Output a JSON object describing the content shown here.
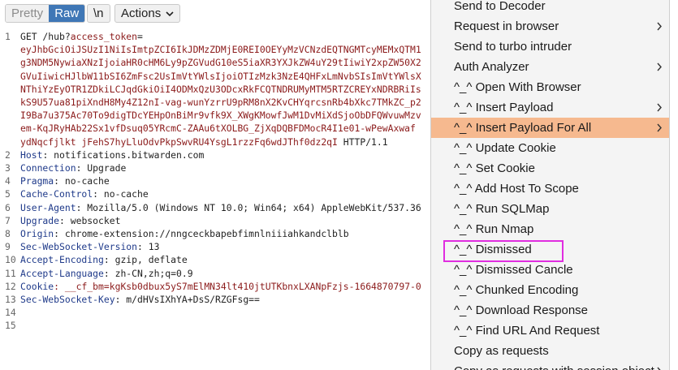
{
  "toolbar": {
    "pretty_label": "Pretty",
    "raw_label": "Raw",
    "newline_label": "\\n",
    "actions_label": "Actions"
  },
  "editor": {
    "line_numbers": [
      "1",
      "",
      "",
      "",
      "",
      "",
      "",
      "",
      "",
      "2",
      "3",
      "4",
      "5",
      "6",
      "7",
      "8",
      "9",
      "10",
      "11",
      "12",
      "13",
      "14",
      "15"
    ],
    "lines": [
      {
        "a": "GET /hub?",
        "b": "access_token",
        "c": "="
      },
      {
        "a": "eyJhbGciOiJSUzI1NiIsImtpZCI6IkJDMzZDMjE0REI0OEYyMzVCNzdEQTNGMTcyMEMxQTM1",
        "b": "",
        "c": ""
      },
      {
        "a": "g3NDM5NywiaXNzIjoiaHR0cHM6Ly9pZGVudG10eS5iaXR3YXJkZW4uY29tIiwiY2xpZW50X2",
        "b": "",
        "c": ""
      },
      {
        "a": "GVuIiwicHJlbW11bSI6ZmFsc2UsImVtYWlsIjoiOTIzMzk3NzE4QHFxLmNvbSIsImVtYWlsX",
        "b": "",
        "c": ""
      },
      {
        "a": "NThiYzEyOTR1ZDkiLCJqdGkiOiI4ODMxQzU3ODcxRkFCQTNDRUMyMTM5RTZCREYxNDRBRiIs",
        "b": "",
        "c": ""
      },
      {
        "a": "kS9U57ua81piXndH8My4Z12nI-vag-wunYzrrU9pRM8nX2KvCHYqrcsnRb4bXkc7TMkZC_p2",
        "b": "",
        "c": ""
      },
      {
        "a": "I9Ba7u375Ac70To9digTDcYEHpOnBiMr9vfk9X_XWgKMowfJwM1DvMiXdSjoObDFQWvuwMzv",
        "b": "",
        "c": ""
      },
      {
        "a": "em-KqJRyHAb22Sx1vfDsuq05YRcmC-ZAAu6tXOLBG_ZjXqDQBFDMocR4I1e01-wPewAxwaf",
        "b": "",
        "c": ""
      },
      {
        "a": "ydNqcfjlkt jFehS7hyLluOdvPkpSwvRU4YsgL1rzzFq6wdJThf0dz2qI",
        "b": "",
        "c": " HTTP/1.1"
      },
      {
        "a": "",
        "b": "Host",
        "c": ": notifications.bitwarden.com"
      },
      {
        "a": "",
        "b": "Connection",
        "c": ": Upgrade"
      },
      {
        "a": "",
        "b": "Pragma",
        "c": ": no-cache"
      },
      {
        "a": "",
        "b": "Cache-Control",
        "c": ": no-cache"
      },
      {
        "a": "",
        "b": "User-Agent",
        "c": ": Mozilla/5.0 (Windows NT 10.0; Win64; x64) AppleWebKit/537.36"
      },
      {
        "a": "",
        "b": "Upgrade",
        "c": ": websocket"
      },
      {
        "a": "",
        "b": "Origin",
        "c": ": chrome-extension://nngceckbapebfimnlniiiahkandclblb"
      },
      {
        "a": "",
        "b": "Sec-WebSocket-Version",
        "c": ": 13"
      },
      {
        "a": "",
        "b": "Accept-Encoding",
        "c": ": gzip, deflate"
      },
      {
        "a": "",
        "b": "Accept-Language",
        "c": ": zh-CN,zh;q=0.9"
      },
      {
        "a": "",
        "b": "Cookie",
        "c": ": __cf_bm=kgKsb0dbux5yS7mElMN34lt410jtUTKbnxLXANpFzjs-1664870797-0"
      },
      {
        "a": "",
        "b": "Sec-WebSocket-Key",
        "c": ": m/dHVsIXhYA+DsS/RZGFsg=="
      },
      {
        "a": "",
        "b": "",
        "c": ""
      },
      {
        "a": "",
        "b": "",
        "c": ""
      }
    ]
  },
  "context_menu": {
    "items": [
      {
        "label": "Send to Decoder",
        "submenu": false,
        "highlighted": false
      },
      {
        "label": "Request in browser",
        "submenu": true,
        "highlighted": false
      },
      {
        "label": "Send to turbo intruder",
        "submenu": false,
        "highlighted": false
      },
      {
        "label": "Auth Analyzer",
        "submenu": true,
        "highlighted": false
      },
      {
        "label": "^_^ Open With Browser",
        "submenu": false,
        "highlighted": false
      },
      {
        "label": "^_^ Insert Payload",
        "submenu": true,
        "highlighted": false
      },
      {
        "label": "^_^ Insert Payload For All",
        "submenu": true,
        "highlighted": true
      },
      {
        "label": "^_^ Update Cookie",
        "submenu": false,
        "highlighted": false
      },
      {
        "label": "^_^ Set Cookie",
        "submenu": false,
        "highlighted": false
      },
      {
        "label": "^_^ Add Host To Scope",
        "submenu": false,
        "highlighted": false
      },
      {
        "label": "^_^ Run SQLMap",
        "submenu": false,
        "highlighted": false
      },
      {
        "label": "^_^ Run Nmap",
        "submenu": false,
        "highlighted": false
      },
      {
        "label": "^_^ Dismissed",
        "submenu": false,
        "highlighted": false
      },
      {
        "label": "^_^ Dismissed Cancle",
        "submenu": false,
        "highlighted": false
      },
      {
        "label": "^_^ Chunked Encoding",
        "submenu": false,
        "highlighted": false
      },
      {
        "label": "^_^ Download Response",
        "submenu": false,
        "highlighted": false
      },
      {
        "label": "^_^ Find URL And Request",
        "submenu": false,
        "highlighted": false
      },
      {
        "label": "Copy as requests",
        "submenu": false,
        "highlighted": false
      },
      {
        "label": "Copy as requests with session object",
        "submenu": true,
        "highlighted": false
      }
    ]
  },
  "colors": {
    "accent": "#3f77b6",
    "menu_highlight": "#f6b98f",
    "annotation_box": "#e02de0"
  }
}
